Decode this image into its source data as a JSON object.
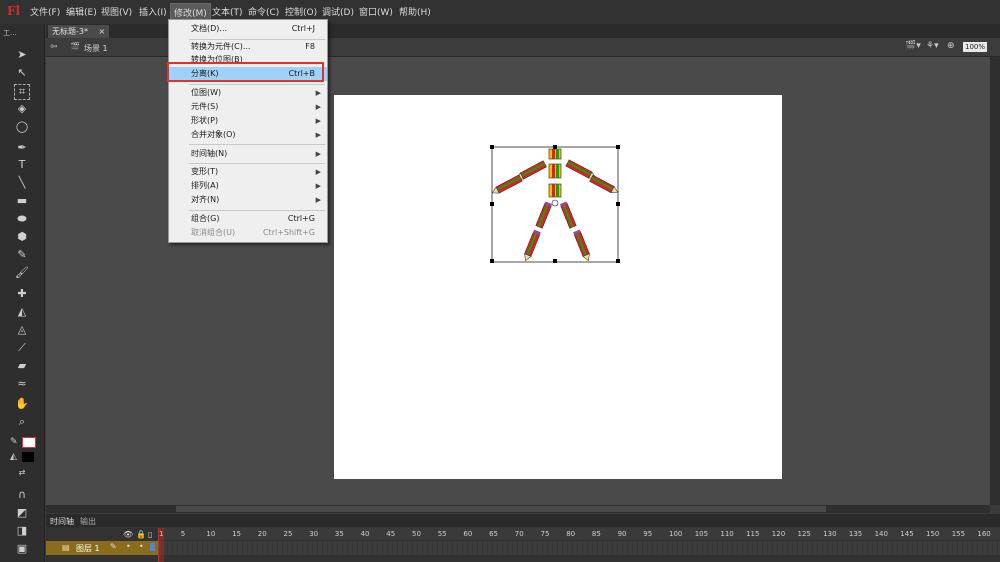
{
  "app": {
    "logo": "Fl"
  },
  "menubar": {
    "items": [
      "文件(F)",
      "编辑(E)",
      "视图(V)",
      "插入(I)",
      "修改(M)",
      "文本(T)",
      "命令(C)",
      "控制(O)",
      "调试(D)",
      "窗口(W)",
      "帮助(H)"
    ],
    "active": "修改(M)"
  },
  "document": {
    "tab_label": "无标题-3*",
    "close_glyph": "×",
    "scene_label": "场景 1",
    "zoom": "100%"
  },
  "toolbar_top_label": "工...",
  "modify_menu": {
    "items": [
      {
        "label": "文档(D)...",
        "shortcut": "Ctrl+J"
      },
      {
        "label": "转换为元件(C)...",
        "shortcut": "F8"
      },
      {
        "label": "转换为位图(B)",
        "shortcut": ""
      },
      {
        "label": "分离(K)",
        "shortcut": "Ctrl+B",
        "highlighted": true
      },
      {
        "label": "位图(W)",
        "submenu": true
      },
      {
        "label": "元件(S)",
        "submenu": true
      },
      {
        "label": "形状(P)",
        "submenu": true
      },
      {
        "label": "合并对象(O)",
        "submenu": true
      },
      {
        "label": "时间轴(N)",
        "submenu": true
      },
      {
        "label": "变形(T)",
        "submenu": true
      },
      {
        "label": "排列(A)",
        "submenu": true
      },
      {
        "label": "对齐(N)",
        "submenu": true
      },
      {
        "label": "组合(G)",
        "shortcut": "Ctrl+G"
      },
      {
        "label": "取消组合(U)",
        "shortcut": "Ctrl+Shift+G",
        "disabled": true
      }
    ]
  },
  "timeline": {
    "tabs": [
      "时间轴",
      "输出"
    ],
    "layer_name": "图层 1",
    "frame_numbers": [
      "1",
      "5",
      "10",
      "15",
      "20",
      "25",
      "30",
      "35",
      "40",
      "45",
      "50",
      "55",
      "60",
      "65",
      "70",
      "75",
      "80",
      "85",
      "90",
      "95",
      "100",
      "105",
      "110",
      "115",
      "120",
      "125",
      "130",
      "135",
      "140",
      "145",
      "150",
      "155",
      "160"
    ]
  },
  "colors": {
    "accent_highlight": "#9fd2f7",
    "callout_border": "#e03030",
    "layer_row": "#8a6d1c"
  }
}
